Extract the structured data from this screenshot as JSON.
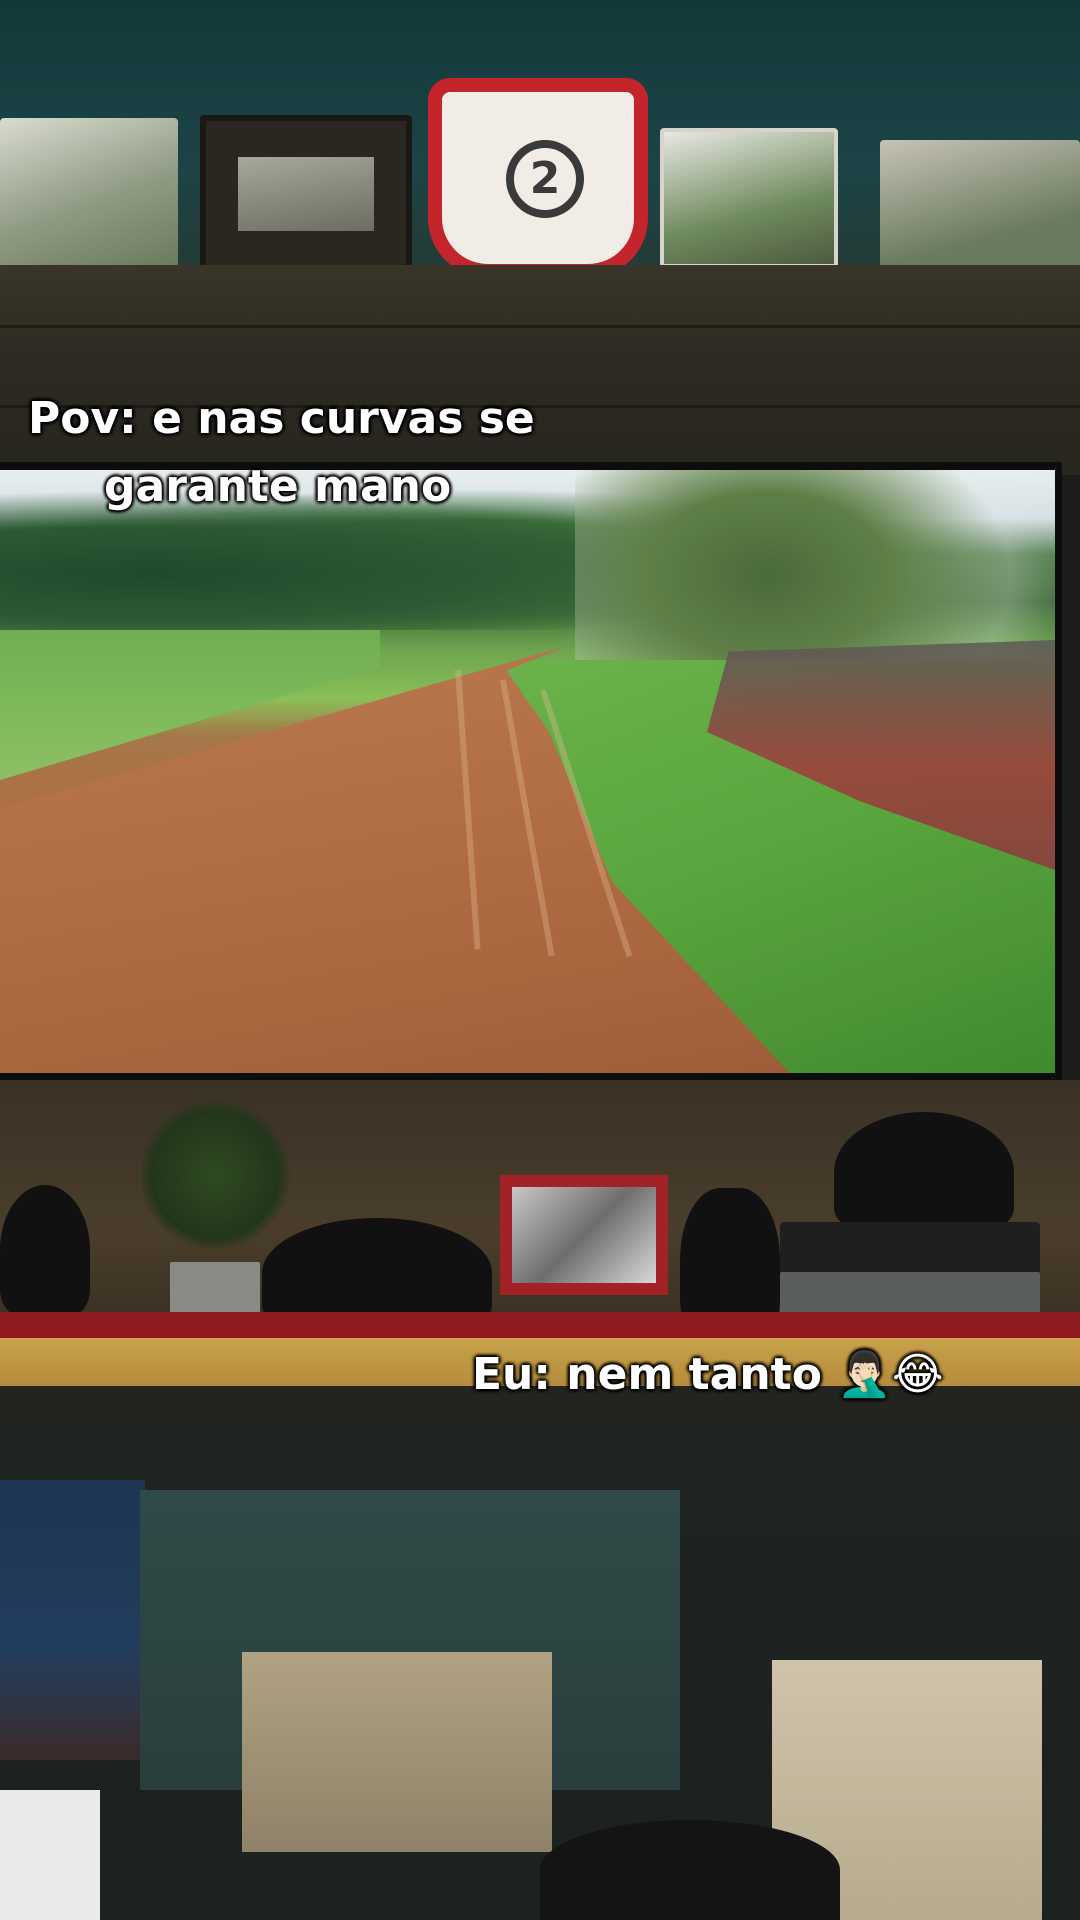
{
  "captions": {
    "top_line1": "Pov: e nas curvas se",
    "top_line2": "garante mano",
    "bottom_text": "Eu: nem tanto",
    "bottom_emojis": "🤦🏻‍♂️😂"
  },
  "photo": {
    "plaque_number": "2"
  }
}
